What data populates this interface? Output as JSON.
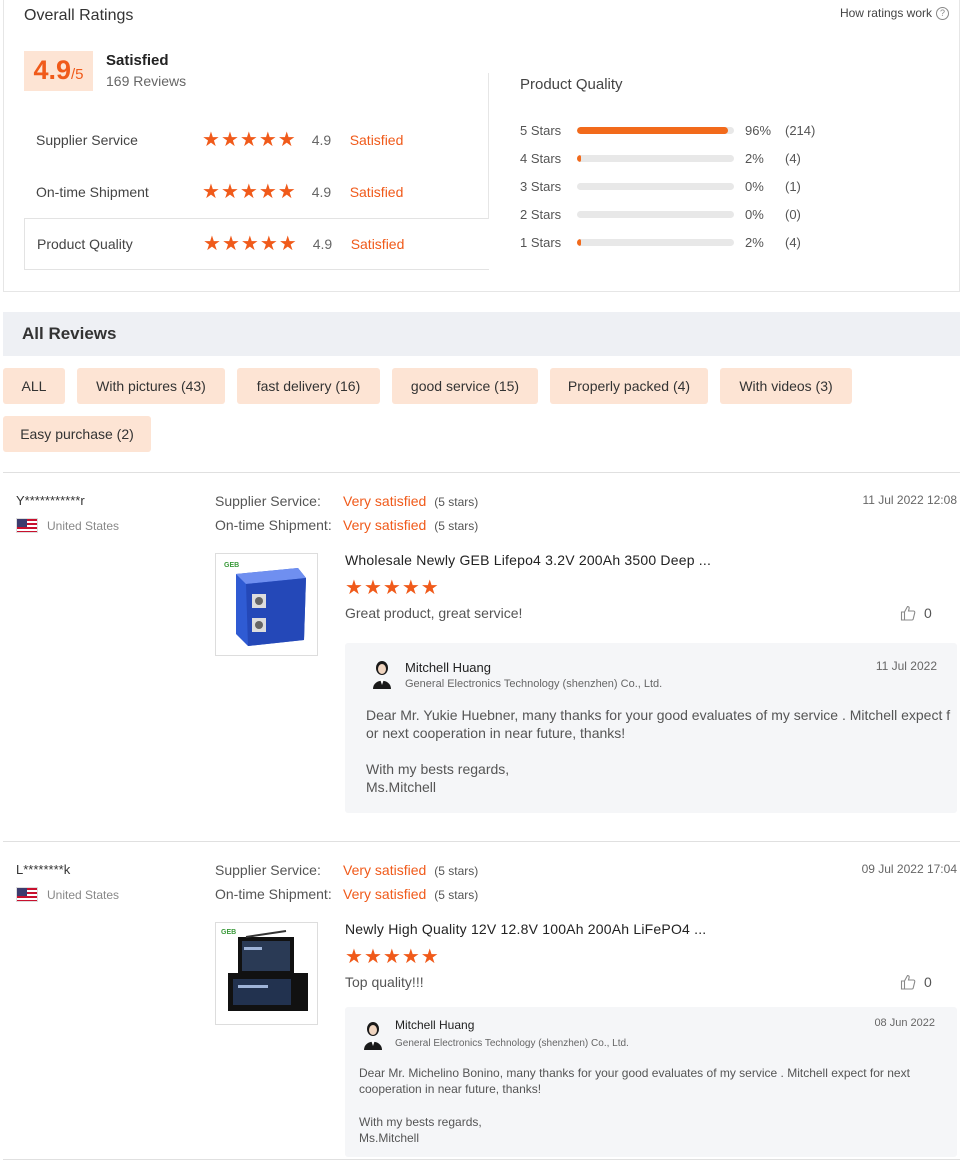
{
  "overall": {
    "title": "Overall Ratings",
    "how_ratings_work": "How ratings work",
    "help_icon": "question-circle-icon",
    "score": "4.9",
    "score_max": "/5",
    "satisfaction": "Satisfied",
    "review_count": "169 Reviews",
    "ratings": [
      {
        "label": "Supplier Service",
        "stars": 5,
        "score": "4.9",
        "satisfaction": "Satisfied"
      },
      {
        "label": "On-time Shipment",
        "stars": 5,
        "score": "4.9",
        "satisfaction": "Satisfied"
      },
      {
        "label": "Product Quality",
        "stars": 5,
        "score": "4.9",
        "satisfaction": "Satisfied"
      }
    ]
  },
  "product_quality": {
    "title": "Product Quality",
    "bars": [
      {
        "label": "5  Stars",
        "percent": 96,
        "pct_text": "96%",
        "count": "(214)"
      },
      {
        "label": "4  Stars",
        "percent": 2,
        "pct_text": "2%",
        "count": "(4)"
      },
      {
        "label": "3  Stars",
        "percent": 0,
        "pct_text": "0%",
        "count": "(1)"
      },
      {
        "label": "2  Stars",
        "percent": 0,
        "pct_text": "0%",
        "count": "(0)"
      },
      {
        "label": "1  Stars",
        "percent": 2,
        "pct_text": "2%",
        "count": "(4)"
      }
    ]
  },
  "all_reviews": {
    "title": "All Reviews",
    "filters": [
      "ALL",
      "With pictures (43)",
      "fast delivery (16)",
      "good service (15)",
      "Properly packed (4)",
      "With videos (3)",
      "Easy purchase (2)"
    ]
  },
  "reviews": [
    {
      "name": "Y***********r",
      "country": "United States",
      "flag_icon": "us-flag-icon",
      "supplier_label": "Supplier Service:",
      "supplier_value": "Very satisfied",
      "supplier_stars": "(5 stars)",
      "shipment_label": "On-time Shipment:",
      "shipment_value": "Very satisfied",
      "shipment_stars": "(5 stars)",
      "date": "11 Jul 2022 12:08",
      "product_title": "Wholesale Newly GEB Lifepo4 3.2V 200Ah 3500 Deep ...",
      "rating": 5,
      "text": "Great product, great service!",
      "likes": "0",
      "reply": {
        "name": "Mitchell Huang",
        "company": "General Electronics Technology (shenzhen) Co., Ltd.",
        "date": "11 Jul 2022",
        "line1": "Dear Mr. Yukie Huebner, many thanks for your good evaluates of my service . Mitchell expect f",
        "line2": "or next cooperation in near future, thanks!",
        "line3": "With my bests regards,",
        "line4": "Ms.Mitchell"
      }
    },
    {
      "name": "L********k",
      "country": "United States",
      "flag_icon": "us-flag-icon",
      "supplier_label": "Supplier Service:",
      "supplier_value": "Very satisfied",
      "supplier_stars": "(5 stars)",
      "shipment_label": "On-time Shipment:",
      "shipment_value": "Very satisfied",
      "shipment_stars": "(5 stars)",
      "date": "09 Jul 2022 17:04",
      "product_title": "Newly High Quality 12V 12.8V 100Ah 200Ah LiFePO4 ...",
      "rating": 5,
      "text": "Top quality!!!",
      "likes": "0",
      "reply": {
        "name": "Mitchell Huang",
        "company": "General Electronics Technology (shenzhen) Co., Ltd.",
        "date": "08 Jun 2022",
        "line1": "Dear Mr. Michelino Bonino, many thanks for your good evaluates of my service . Mitchell expect for next",
        "line2": "cooperation in near future, thanks!",
        "line3": "With my bests regards,",
        "line4": "Ms.Mitchell"
      }
    }
  ],
  "colors": {
    "accent": "#f05a1a",
    "tag_bg": "#fde4d4",
    "header_bg": "#eef0f4"
  }
}
